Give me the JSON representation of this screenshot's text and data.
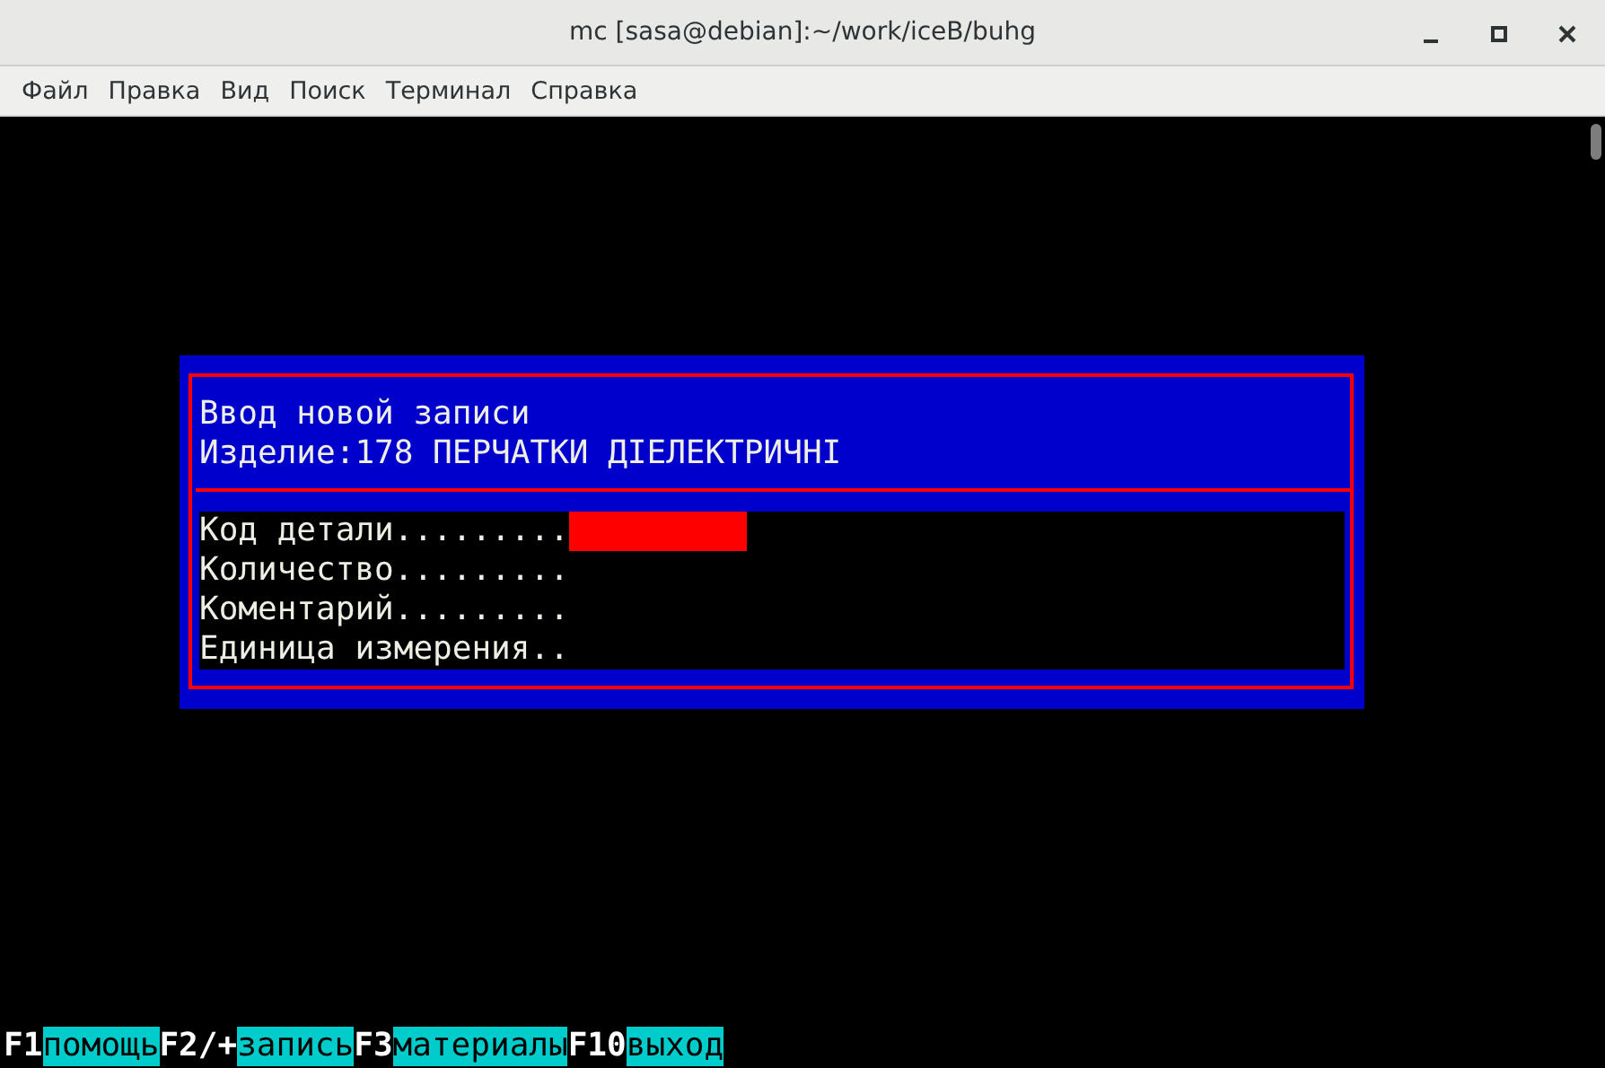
{
  "window": {
    "title": "mc [sasa@debian]:~/work/iceB/buhg"
  },
  "menu": [
    "Файл",
    "Правка",
    "Вид",
    "Поиск",
    "Терминал",
    "Справка"
  ],
  "dialog": {
    "title": "Ввод новой записи",
    "subtitle": "Изделие:178 ПЕРЧАТКИ ДІЕЛЕКТРИЧНІ",
    "fields": [
      {
        "label": "Код детали.........",
        "focused": true
      },
      {
        "label": "Количество.........",
        "focused": false
      },
      {
        "label": "Коментарий.........",
        "focused": false
      },
      {
        "label": "Единица измерения..",
        "focused": false
      }
    ]
  },
  "keybar": [
    {
      "key": "F1",
      "label": "помощь"
    },
    {
      "key": "F2/+",
      "label": "запись"
    },
    {
      "key": "F3",
      "label": "материалы"
    },
    {
      "key": "F10",
      "label": "выход"
    }
  ]
}
